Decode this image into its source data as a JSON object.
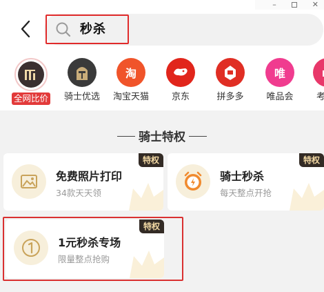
{
  "search": {
    "query": "秒杀"
  },
  "platforms": [
    {
      "label": "全网比价",
      "icon": "all-web-icon",
      "color": "#3b3030"
    },
    {
      "label": "骑士优选",
      "icon": "knight-helmet-icon",
      "color": "#3a3a3a"
    },
    {
      "label": "淘宝天猫",
      "icon_text": "淘",
      "color": "#f0542a"
    },
    {
      "label": "京东",
      "icon": "jd-dog-icon",
      "color": "#e1251b"
    },
    {
      "label": "拼多多",
      "icon": "pdd-icon",
      "color": "#e02e24"
    },
    {
      "label": "唯品会",
      "icon_text": "唯",
      "color": "#f03c8f"
    },
    {
      "label": "考",
      "icon": "partial-icon",
      "color": "#e8386a"
    }
  ],
  "section": {
    "title": "骑士特权"
  },
  "cards": [
    {
      "title": "免费照片打印",
      "subtitle": "34款天天领",
      "badge": "特权",
      "icon": "photo-icon"
    },
    {
      "title": "骑士秒杀",
      "subtitle": "每天整点开抢",
      "badge": "特权",
      "icon": "alarm-clock-icon"
    },
    {
      "title": "1元秒杀专场",
      "subtitle": "限量整点抢购",
      "badge": "特权",
      "icon": "number-one-coin-icon"
    }
  ],
  "colors": {
    "accent": "#e23a3a",
    "badge_bg": "#332b25",
    "badge_text": "#f3d9a4"
  }
}
